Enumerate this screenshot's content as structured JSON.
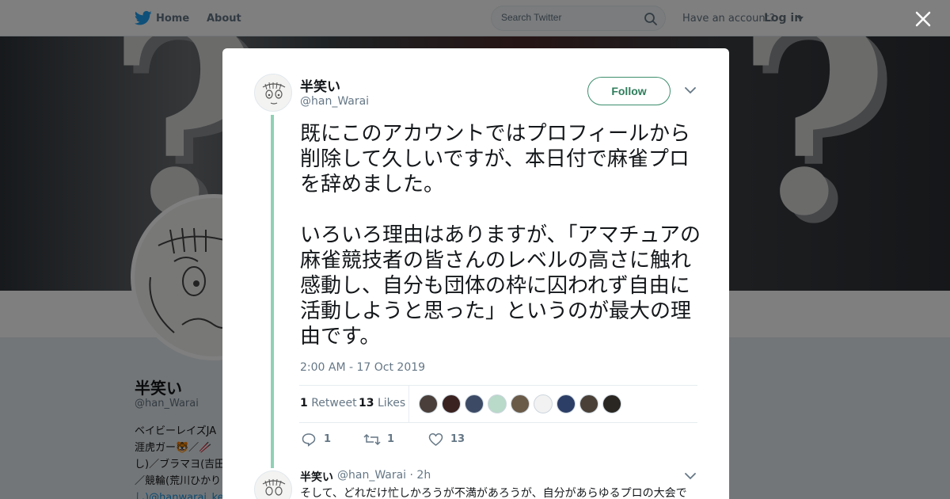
{
  "topbar": {
    "home_label": "Home",
    "about_label": "About",
    "search_placeholder": "Search Twitter",
    "have_account": "Have an account?",
    "login_label": "Log in"
  },
  "background_profile": {
    "name": "半笑い",
    "handle": "@han_Warai",
    "bio_lines": [
      "ベイビーレイズJA",
      "涯虎ガー🐯／🥢",
      "し)／ブラマヨ(吉田",
      "／競輪(荒川ひかり",
      "し)@hanwarai_ke"
    ]
  },
  "tweet": {
    "author_name": "半笑い",
    "author_handle": "@han_Warai",
    "follow_label": "Follow",
    "text": "既にこのアカウントではプロフィールから削除して久しいですが、本日付で麻雀プロを辞めました。\n\nいろいろ理由はありますが、「アマチュアの麻雀競技者の皆さんのレベルの高さに触れ感動し、自分も団体の枠に囚われず自由に活動しようと思った」というのが最大の理由です。",
    "timestamp": "2:00 AM - 17 Oct 2019",
    "retweets_count": "1",
    "retweets_label": "Retweet",
    "likes_count": "13",
    "likes_label": "Likes",
    "liker_avatars": [
      "#4a3f3a",
      "#3a2220",
      "#3d4a66",
      "#b9d9c9",
      "#6a5a48",
      "#f2f2f2",
      "#2c3d66",
      "#4a4038",
      "#2a2622"
    ],
    "actions": {
      "reply_count": "1",
      "retweet_count": "1",
      "like_count": "13"
    }
  },
  "reply": {
    "author_name": "半笑い",
    "meta": "@han_Warai · 2h",
    "text": "そして、どれだけ忙しかろうが不満があろうが、自分があらゆるプロの大会で"
  },
  "colors": {
    "brand_blue": "#1da1f2",
    "follow_green": "#2f7d5c",
    "thread_line": "#8fd1b5"
  },
  "icons": [
    "twitter-bird-icon",
    "search-icon",
    "close-icon",
    "chevron-down-icon",
    "reply-icon",
    "retweet-icon",
    "heart-icon"
  ]
}
